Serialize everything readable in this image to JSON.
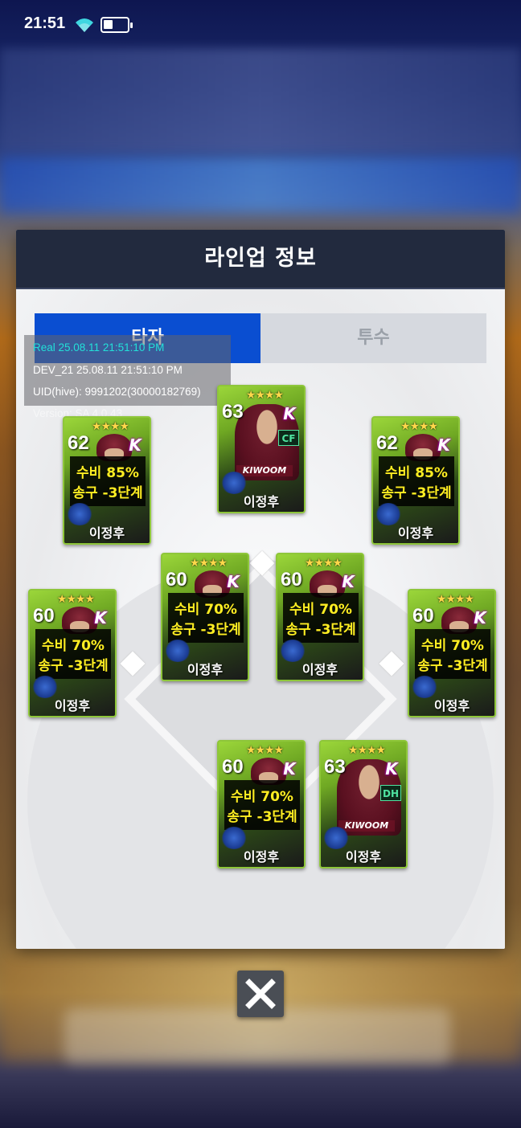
{
  "status_bar": {
    "time": "21:51",
    "battery_level": 0.4
  },
  "dialog": {
    "title": "라인업 정보"
  },
  "tabs": [
    {
      "label": "타자",
      "active": true
    },
    {
      "label": "투수",
      "active": false
    }
  ],
  "debug": {
    "real": "Real   25.08.11 21:51:10 PM",
    "dev": "DEV_21   25.08.11 21:51:10 PM",
    "uid": "UID(hive): 9991202(30000182769)",
    "version": "Version: SA 4.0.43"
  },
  "cards": [
    {
      "stars": "★★★★",
      "rating": "62",
      "team": "K",
      "stat1": "수비 85%",
      "stat2": "송구 -3단계",
      "name": "이정후"
    },
    {
      "stars": "★★★★",
      "rating": "63",
      "team": "K",
      "position": "CF",
      "jersey": "KIWOOM",
      "name": "이정후"
    },
    {
      "stars": "★★★★",
      "rating": "62",
      "team": "K",
      "stat1": "수비 85%",
      "stat2": "송구 -3단계",
      "name": "이정후"
    },
    {
      "stars": "★★★★",
      "rating": "60",
      "team": "K",
      "stat1": "수비 70%",
      "stat2": "송구 -3단계",
      "name": "이정후"
    },
    {
      "stars": "★★★★",
      "rating": "60",
      "team": "K",
      "stat1": "수비 70%",
      "stat2": "송구 -3단계",
      "name": "이정후"
    },
    {
      "stars": "★★★★",
      "rating": "60",
      "team": "K",
      "stat1": "수비 70%",
      "stat2": "송구 -3단계",
      "name": "이정후"
    },
    {
      "stars": "★★★★",
      "rating": "60",
      "team": "K",
      "stat1": "수비 70%",
      "stat2": "송구 -3단계",
      "name": "이정후"
    },
    {
      "stars": "★★★★",
      "rating": "60",
      "team": "K",
      "stat1": "수비 70%",
      "stat2": "송구 -3단계",
      "name": "이정후"
    },
    {
      "stars": "★★★★",
      "rating": "63",
      "team": "K",
      "position": "DH",
      "jersey": "KIWOOM",
      "name": "이정후"
    }
  ],
  "colors": {
    "accent": "#0a4ed1",
    "header": "#222a3e",
    "card_green": "#8ec63a",
    "stat_yellow": "#ffee22"
  },
  "icons": {
    "close": "close-icon",
    "wifi": "wifi-icon",
    "battery": "battery-icon"
  }
}
